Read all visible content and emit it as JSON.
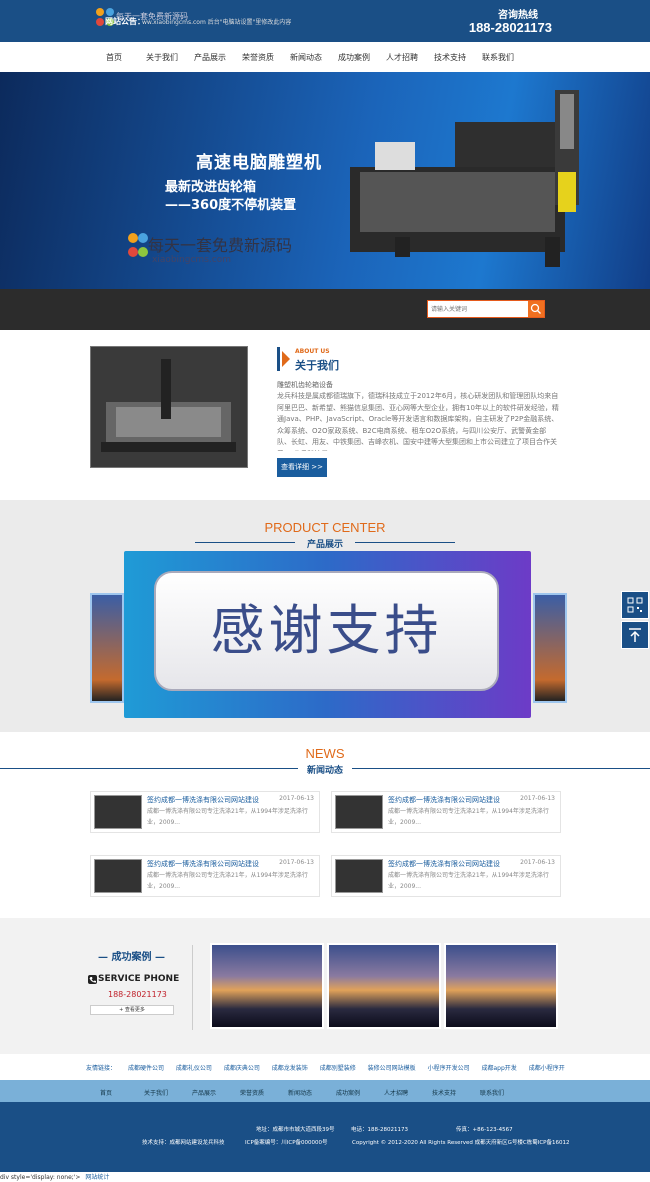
{
  "header": {
    "logo_text": "每天一套免费新源码",
    "hotline_label": "咨询热线",
    "hotline_number": "188-28021173"
  },
  "nav": [
    "首页",
    "关于我们",
    "产品展示",
    "荣誉资质",
    "新闻动态",
    "成功案例",
    "人才招聘",
    "技术支持",
    "联系我们"
  ],
  "banner": {
    "line1": "高速电脑雕塑机",
    "line2": "最新改进齿轮箱",
    "line3": "——360度不停机装置",
    "watermark_cn": "每天一套免费新源码",
    "watermark_en": "xiaobingcms.com"
  },
  "notice": {
    "label": "网站公告：",
    "text": "ww.xiaobingcms.com 后台\"电脑站设置\"里修改此内容",
    "search_placeholder": "请输入关键词"
  },
  "about": {
    "en": "ABOUT US",
    "cn": "关于我们",
    "subtitle": "雕塑机齿轮箱设备",
    "body": "龙兵科技是属成都德瑞旗下，德瑞科技成立于2012年6月，核心研发团队和管理团队均来自阿里巴巴、新希望、熊猫信息集团、亚心网等大型企业，拥有10年以上的软件研发经验，精通Java、PHP、JavaScript、Oracle等开发语言和数据库架构，自主研发了P2P金融系统、众筹系统、O2O家政系统、B2C电商系统、租车O2O系统，与四川公安厅、武警黄金部队、长虹、用友、中铁集团、吉峰农机、国安中建等大型集团和上市公司建立了项目合作关系。 龙兵科技是",
    "more": "查看详细 >>"
  },
  "product": {
    "en": "PRODUCT CENTER",
    "cn": "产品展示",
    "overlay": "感谢支持"
  },
  "news": {
    "en": "NEWS",
    "cn": "新闻动态",
    "items": [
      {
        "title": "签约成都一博洗涤有限公司网站建设",
        "date": "2017-06-13",
        "desc": "成都一博洗涤有限公司专注洗涤21年，从1994年涉足洗涤行业，2009..."
      },
      {
        "title": "签约成都一博洗涤有限公司网站建设",
        "date": "2017-06-13",
        "desc": "成都一博洗涤有限公司专注洗涤21年，从1994年涉足洗涤行业，2009..."
      },
      {
        "title": "签约成都一博洗涤有限公司网站建设",
        "date": "2017-06-13",
        "desc": "成都一博洗涤有限公司专注洗涤21年，从1994年涉足洗涤行业，2009..."
      },
      {
        "title": "签约成都一博洗涤有限公司网站建设",
        "date": "2017-06-13",
        "desc": "成都一博洗涤有限公司专注洗涤21年，从1994年涉足洗涤行业，2009..."
      }
    ]
  },
  "cases": {
    "title": "— 成功案例 —",
    "service_label": "SERVICE PHONE",
    "service_phone": "188-28021173",
    "more": "查看更多"
  },
  "links": {
    "label": "友情链接：",
    "items": [
      "成都硬件公司",
      "成都礼仪公司",
      "成都庆典公司",
      "成都龙发装饰",
      "成都别墅装修",
      "装修公司网站模板",
      "小程序开发公司",
      "成都app开发",
      "成都小程序开"
    ]
  },
  "footer_nav": [
    "首页",
    "关于我们",
    "产品展示",
    "荣誉资质",
    "新闻动态",
    "成功案例",
    "人才招聘",
    "技术支持",
    "联系我们"
  ],
  "footer": {
    "address": "地址：成都市市城大道西段39号",
    "phone": "电话：188-28021173",
    "fax": "传真：+86-123-4567",
    "support": "技术支持：成都网站建设龙兵科技",
    "icp": "ICP备案编号：川ICP备000000号",
    "copyright": "Copyright © 2012-2020 All Rights Reserved 成都天府新区G号楼C栋蜀ICP备16012"
  },
  "bottom": {
    "code": "div style='display: none;'>",
    "link": "网站统计"
  }
}
